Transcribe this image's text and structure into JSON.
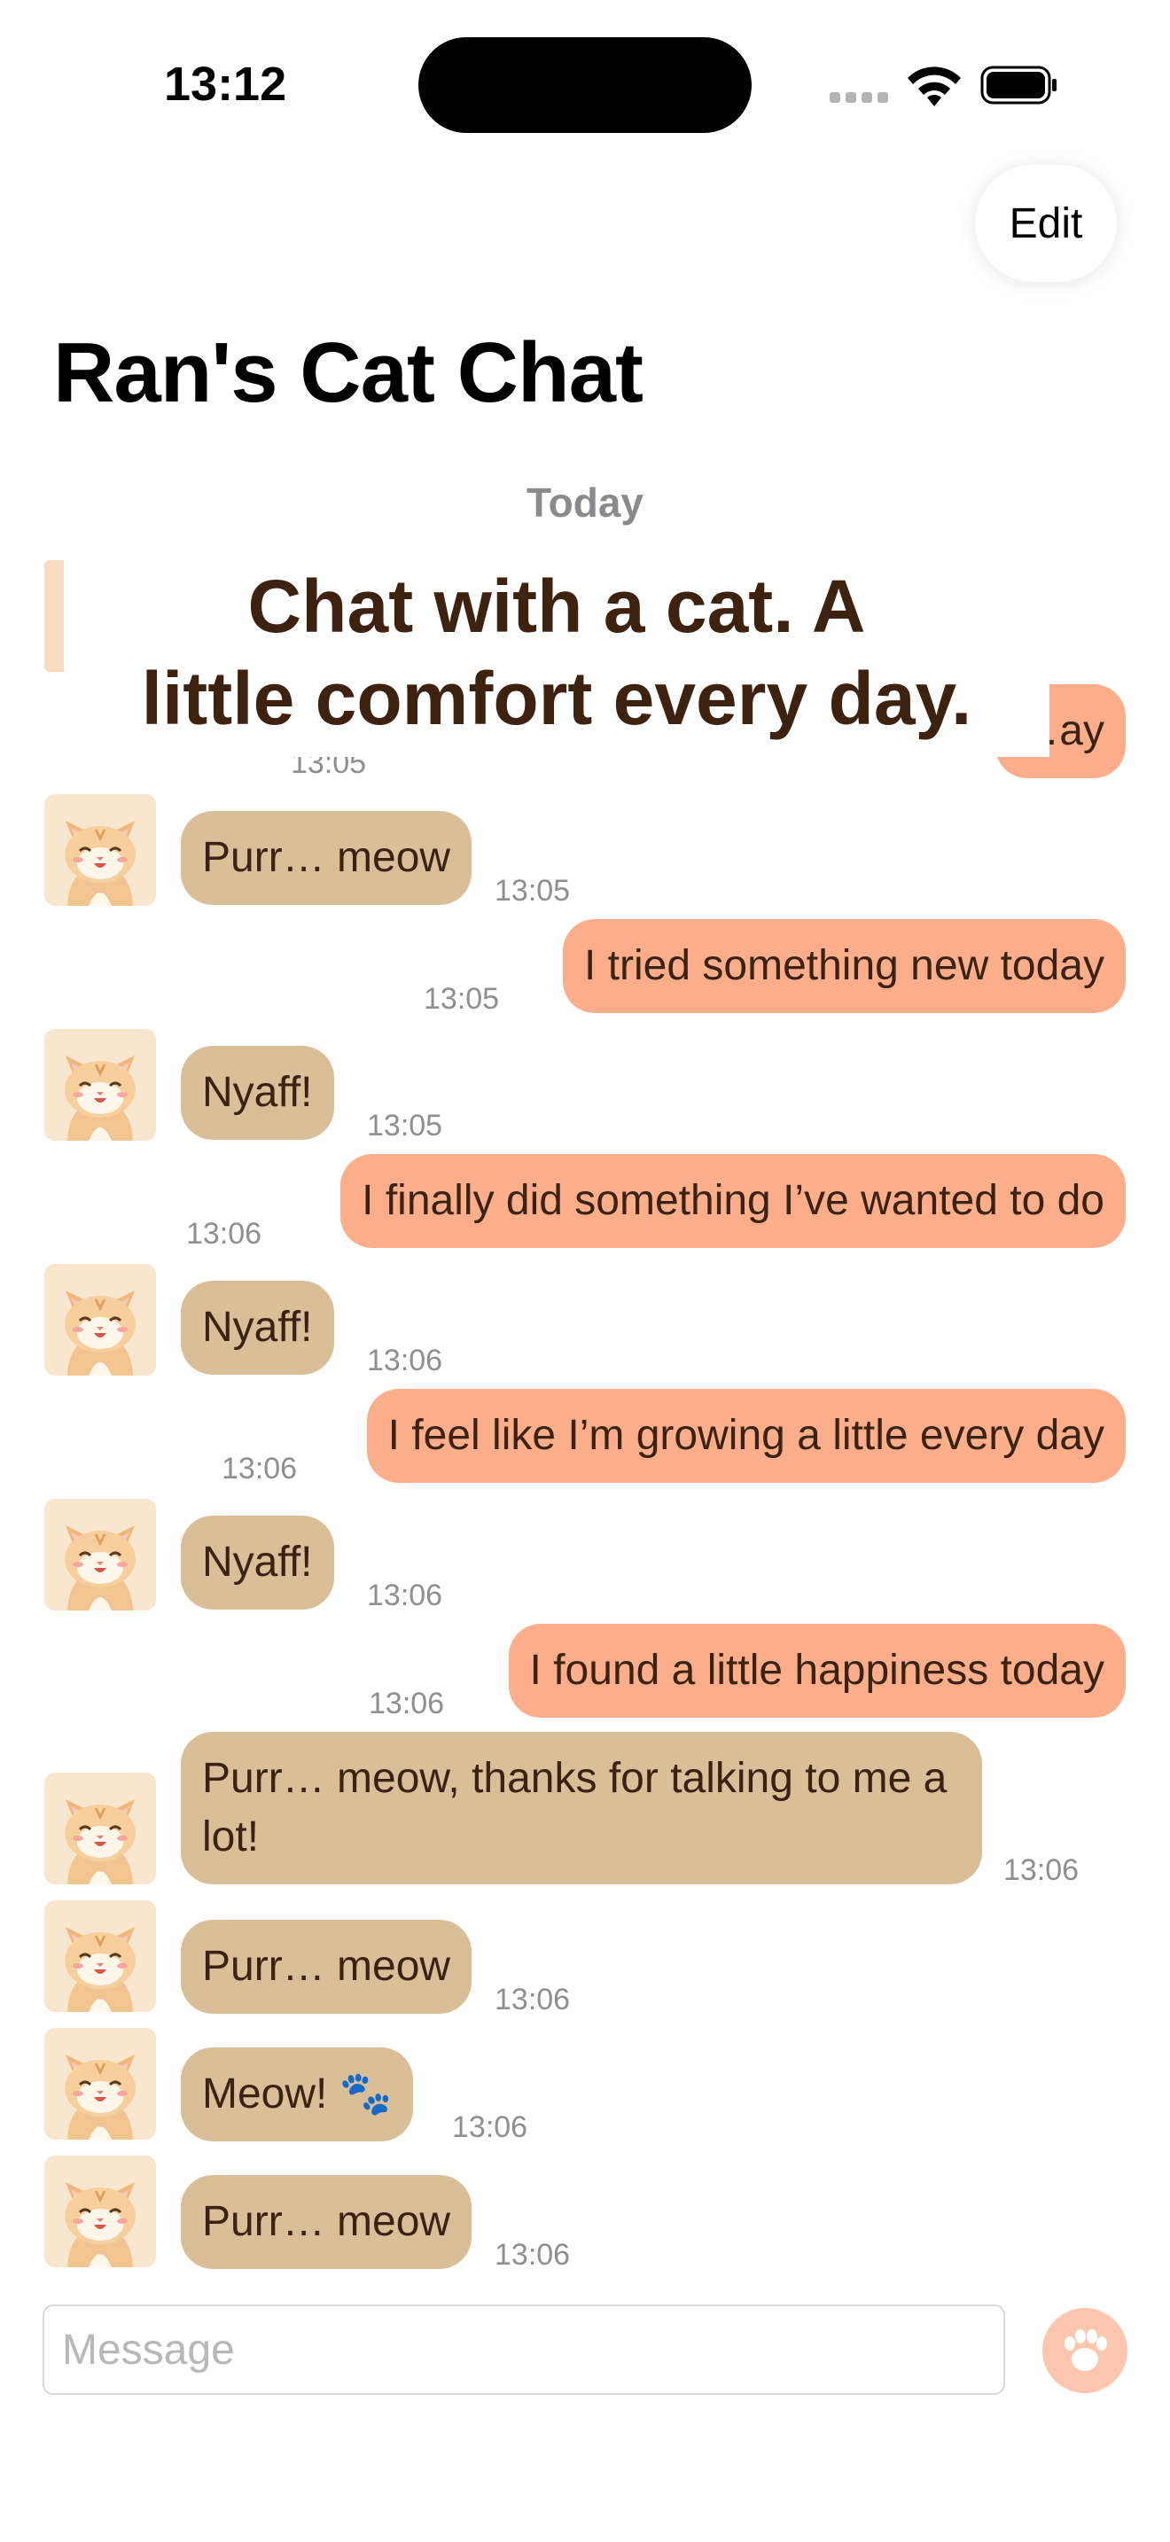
{
  "status_bar": {
    "time": "13:12"
  },
  "header": {
    "edit_label": "Edit",
    "title": "Ran's Cat Chat"
  },
  "date_separator": "Today",
  "promo_banner": {
    "line1": "Chat with a cat. A",
    "line2": "little comfort every day."
  },
  "messages": [
    {
      "sender": "user",
      "text": "…ay",
      "time": "13:05"
    },
    {
      "sender": "cat",
      "text": "Purr… meow",
      "time": "13:05"
    },
    {
      "sender": "user",
      "text": "I tried something new today",
      "time": "13:05"
    },
    {
      "sender": "cat",
      "text": "Nyaff!",
      "time": "13:05"
    },
    {
      "sender": "user",
      "text": "I finally did something I’ve wanted to do",
      "time": "13:06"
    },
    {
      "sender": "cat",
      "text": "Nyaff!",
      "time": "13:06"
    },
    {
      "sender": "user",
      "text": "I feel like I’m growing a little every day",
      "time": "13:06"
    },
    {
      "sender": "cat",
      "text": "Nyaff!",
      "time": "13:06"
    },
    {
      "sender": "user",
      "text": "I found a little happiness today",
      "time": "13:06"
    },
    {
      "sender": "cat",
      "text": "Purr… meow, thanks for talking to me a lot!",
      "time": "13:06"
    },
    {
      "sender": "cat",
      "text": "Purr… meow",
      "time": "13:06"
    },
    {
      "sender": "cat",
      "text": "Meow! 🐾",
      "time": "13:06"
    },
    {
      "sender": "cat",
      "text": "Purr… meow",
      "time": "13:06"
    }
  ],
  "composer": {
    "placeholder": "Message",
    "send_icon": "paw-icon"
  },
  "colors": {
    "cat_bubble": "#d8bf98",
    "user_bubble": "#fcae8a",
    "text": "#3b2313",
    "send_button": "#fdc6ae"
  }
}
